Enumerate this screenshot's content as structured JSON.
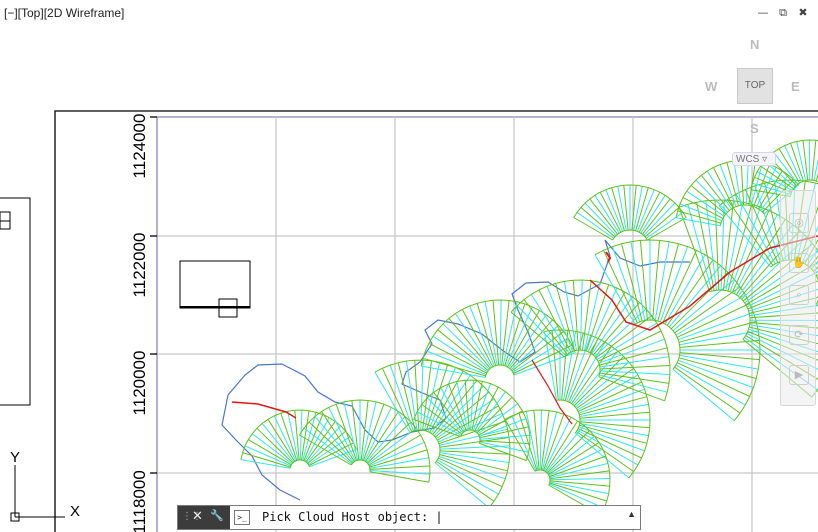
{
  "viewport": {
    "label": "[−][Top][2D Wireframe]"
  },
  "window_controls": {
    "minimize": "—",
    "restore": "⧉",
    "close": "✖"
  },
  "viewcube": {
    "north": "N",
    "south": "S",
    "east": "E",
    "west": "W",
    "face": "TOP",
    "wcs": "WCS ▿"
  },
  "ucs": {
    "y": "Y",
    "x": "X"
  },
  "axis": {
    "labels": [
      "1124000",
      "1122000",
      "1120000",
      "1118000"
    ]
  },
  "command": {
    "prompt": "Pick Cloud Host object: |",
    "close_icon": "✕",
    "settings_icon": "🔧",
    "prompt_icon": ">_",
    "arrow": "▲"
  },
  "colors": {
    "grid": "#c8c8c8",
    "boundary": "#4a78c8",
    "hatch_green": "#5fc01e",
    "hatch_cyan": "#30e8e8",
    "breakline": "#e41616"
  },
  "navbar_icons": [
    "full-navigation-wheel-icon",
    "pan-icon",
    "zoom-icon",
    "orbit-icon",
    "showmotion-icon"
  ]
}
